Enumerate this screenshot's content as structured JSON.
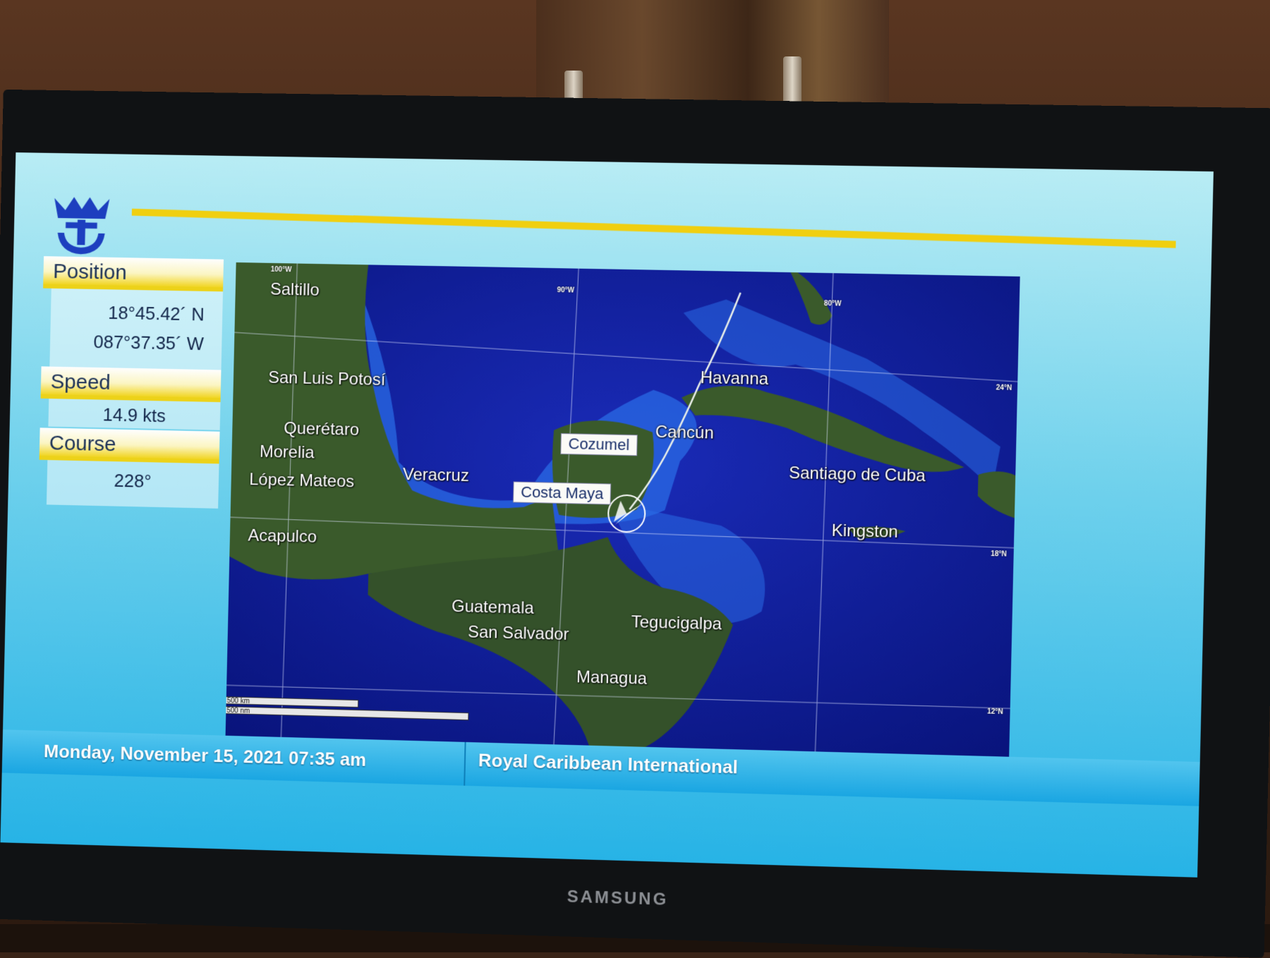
{
  "brand": "SAMSUNG",
  "panel": {
    "position_label": "Position",
    "latitude": "18°45.42´ N",
    "longitude": "087°37.35´ W",
    "speed_label": "Speed",
    "speed_value": "14.9 kts",
    "course_label": "Course",
    "course_value": "228°"
  },
  "map": {
    "cities": {
      "saltillo": "Saltillo",
      "san_luis_potosi": "San Luis Potosí",
      "queretaro": "Querétaro",
      "morelia": "Morelia",
      "lopez_mateos": "López Mateos",
      "veracruz": "Veracruz",
      "acapulco": "Acapulco",
      "guatemala": "Guatemala",
      "san_salvador": "San Salvador",
      "tegucigalpa": "Tegucigalpa",
      "managua": "Managua",
      "havanna": "Havanna",
      "cancun": "Cancún",
      "santiago_de_cuba": "Santiago de Cuba",
      "kingston": "Kingston"
    },
    "ports": {
      "cozumel": "Cozumel",
      "costa_maya": "Costa Maya"
    },
    "grid_labels": {
      "lon_100": "100°W",
      "lon_90": "90°W",
      "lon_80": "80°W",
      "lat_24": "24°N",
      "lat_18": "18°N",
      "lat_12": "12°N"
    },
    "scale": {
      "km": "500 km",
      "nm": "500 nm"
    },
    "colors": {
      "ocean": "#0c1a9c",
      "shallow": "#2a6be6",
      "land": "#34512a",
      "route": "#e9efe9"
    }
  },
  "footer": {
    "datetime": "Monday, November 15, 2021 07:35 am",
    "company": "Royal Caribbean International"
  }
}
